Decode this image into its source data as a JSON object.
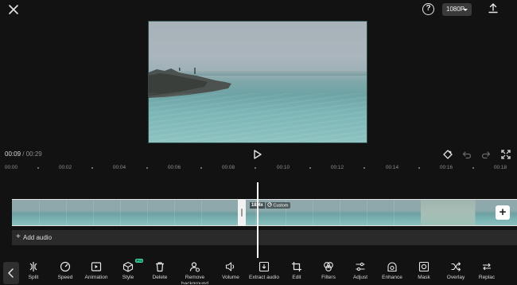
{
  "header": {
    "resolution": "1080P",
    "help_symbol": "?",
    "icons": {
      "close": "close-icon",
      "help": "help-icon",
      "export": "export-icon"
    }
  },
  "player": {
    "current_time": "00:09",
    "separator": " / ",
    "total_time": "00:29",
    "icons": [
      "play-icon",
      "keyframe-icon",
      "undo-icon",
      "redo-icon",
      "fullscreen-icon"
    ]
  },
  "ruler": {
    "labels": [
      "00:00",
      "00:02",
      "00:04",
      "00:06",
      "00:08",
      "00:10",
      "00:12",
      "00:14",
      "00:16",
      "00:18"
    ]
  },
  "timeline": {
    "speed_badge": "18.4x",
    "custom_badge": "Custom",
    "add_clip_symbol": "+",
    "add_audio_symbol": "+",
    "add_audio_label": "Add audio"
  },
  "toolbar": {
    "pro_badge": "Pro",
    "tools": [
      {
        "label": "Split",
        "icon": "split-icon"
      },
      {
        "label": "Speed",
        "icon": "speed-icon"
      },
      {
        "label": "Animation",
        "icon": "animation-icon"
      },
      {
        "label": "Style",
        "icon": "style-icon"
      },
      {
        "label": "Delete",
        "icon": "delete-icon"
      },
      {
        "label": "Remove",
        "label2": "background",
        "icon": "remove-background-icon"
      },
      {
        "label": "Volume",
        "icon": "volume-icon"
      },
      {
        "label": "Extract audio",
        "icon": "extract-audio-icon"
      },
      {
        "label": "Edit",
        "icon": "edit-icon"
      },
      {
        "label": "Filters",
        "icon": "filters-icon"
      },
      {
        "label": "Adjust",
        "icon": "adjust-icon"
      },
      {
        "label": "Enhance",
        "icon": "enhance-icon"
      },
      {
        "label": "Mask",
        "icon": "mask-icon"
      },
      {
        "label": "Overlay",
        "icon": "overlay-icon"
      },
      {
        "label": "Replac",
        "icon": "replace-icon"
      }
    ]
  },
  "colors": {
    "background": "#121212",
    "audio_row": "#2a2a2a",
    "playhead": "#ffffff",
    "pro_badge": "#3ad4a0"
  }
}
